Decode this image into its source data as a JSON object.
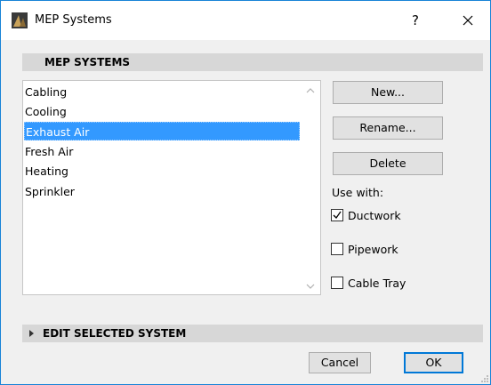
{
  "window": {
    "title": "MEP Systems",
    "help": "?"
  },
  "section_top": {
    "label": "MEP SYSTEMS"
  },
  "systems_list": {
    "items": [
      {
        "label": "Cabling",
        "selected": false
      },
      {
        "label": "Cooling",
        "selected": false
      },
      {
        "label": "Exhaust Air",
        "selected": true
      },
      {
        "label": "Fresh Air",
        "selected": false
      },
      {
        "label": "Heating",
        "selected": false
      },
      {
        "label": "Sprinkler",
        "selected": false
      }
    ]
  },
  "buttons": {
    "new": "New...",
    "rename": "Rename...",
    "delete": "Delete"
  },
  "use_with": {
    "label": "Use with:",
    "options": [
      {
        "label": "Ductwork",
        "checked": true
      },
      {
        "label": "Pipework",
        "checked": false
      },
      {
        "label": "Cable Tray",
        "checked": false
      }
    ]
  },
  "section_bottom": {
    "label": "EDIT SELECTED SYSTEM"
  },
  "footer": {
    "cancel": "Cancel",
    "ok": "OK"
  },
  "colors": {
    "selection": "#3399ff",
    "accent": "#0078d7",
    "section_bar": "#d7d7d7"
  }
}
